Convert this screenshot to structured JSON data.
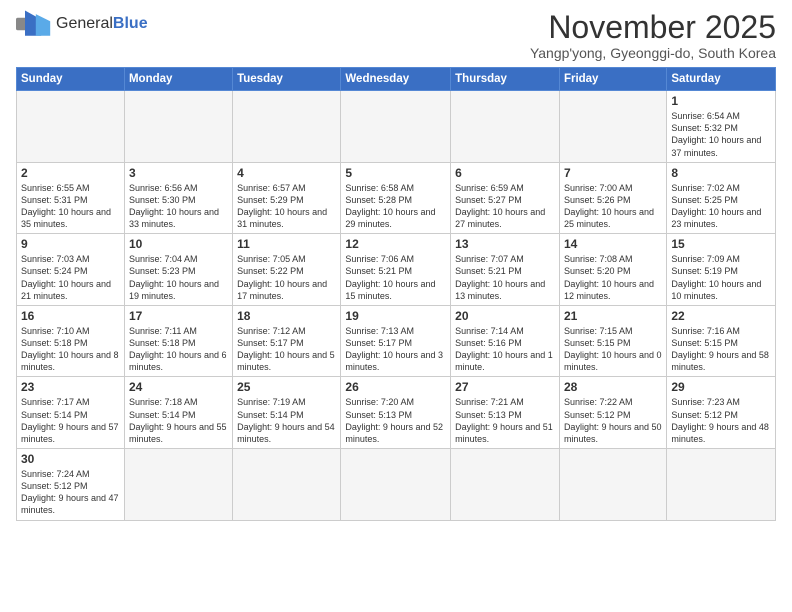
{
  "header": {
    "logo_general": "General",
    "logo_blue": "Blue",
    "month_title": "November 2025",
    "location": "Yangp'yong, Gyeonggi-do, South Korea"
  },
  "weekdays": [
    "Sunday",
    "Monday",
    "Tuesday",
    "Wednesday",
    "Thursday",
    "Friday",
    "Saturday"
  ],
  "weeks": [
    [
      {
        "day": "",
        "empty": true
      },
      {
        "day": "",
        "empty": true
      },
      {
        "day": "",
        "empty": true
      },
      {
        "day": "",
        "empty": true
      },
      {
        "day": "",
        "empty": true
      },
      {
        "day": "",
        "empty": true
      },
      {
        "day": "1",
        "sunrise": "6:54 AM",
        "sunset": "5:32 PM",
        "daylight": "10 hours and 37 minutes."
      }
    ],
    [
      {
        "day": "2",
        "sunrise": "6:55 AM",
        "sunset": "5:31 PM",
        "daylight": "10 hours and 35 minutes."
      },
      {
        "day": "3",
        "sunrise": "6:56 AM",
        "sunset": "5:30 PM",
        "daylight": "10 hours and 33 minutes."
      },
      {
        "day": "4",
        "sunrise": "6:57 AM",
        "sunset": "5:29 PM",
        "daylight": "10 hours and 31 minutes."
      },
      {
        "day": "5",
        "sunrise": "6:58 AM",
        "sunset": "5:28 PM",
        "daylight": "10 hours and 29 minutes."
      },
      {
        "day": "6",
        "sunrise": "6:59 AM",
        "sunset": "5:27 PM",
        "daylight": "10 hours and 27 minutes."
      },
      {
        "day": "7",
        "sunrise": "7:00 AM",
        "sunset": "5:26 PM",
        "daylight": "10 hours and 25 minutes."
      },
      {
        "day": "8",
        "sunrise": "7:02 AM",
        "sunset": "5:25 PM",
        "daylight": "10 hours and 23 minutes."
      }
    ],
    [
      {
        "day": "9",
        "sunrise": "7:03 AM",
        "sunset": "5:24 PM",
        "daylight": "10 hours and 21 minutes."
      },
      {
        "day": "10",
        "sunrise": "7:04 AM",
        "sunset": "5:23 PM",
        "daylight": "10 hours and 19 minutes."
      },
      {
        "day": "11",
        "sunrise": "7:05 AM",
        "sunset": "5:22 PM",
        "daylight": "10 hours and 17 minutes."
      },
      {
        "day": "12",
        "sunrise": "7:06 AM",
        "sunset": "5:21 PM",
        "daylight": "10 hours and 15 minutes."
      },
      {
        "day": "13",
        "sunrise": "7:07 AM",
        "sunset": "5:21 PM",
        "daylight": "10 hours and 13 minutes."
      },
      {
        "day": "14",
        "sunrise": "7:08 AM",
        "sunset": "5:20 PM",
        "daylight": "10 hours and 12 minutes."
      },
      {
        "day": "15",
        "sunrise": "7:09 AM",
        "sunset": "5:19 PM",
        "daylight": "10 hours and 10 minutes."
      }
    ],
    [
      {
        "day": "16",
        "sunrise": "7:10 AM",
        "sunset": "5:18 PM",
        "daylight": "10 hours and 8 minutes."
      },
      {
        "day": "17",
        "sunrise": "7:11 AM",
        "sunset": "5:18 PM",
        "daylight": "10 hours and 6 minutes."
      },
      {
        "day": "18",
        "sunrise": "7:12 AM",
        "sunset": "5:17 PM",
        "daylight": "10 hours and 5 minutes."
      },
      {
        "day": "19",
        "sunrise": "7:13 AM",
        "sunset": "5:17 PM",
        "daylight": "10 hours and 3 minutes."
      },
      {
        "day": "20",
        "sunrise": "7:14 AM",
        "sunset": "5:16 PM",
        "daylight": "10 hours and 1 minute."
      },
      {
        "day": "21",
        "sunrise": "7:15 AM",
        "sunset": "5:15 PM",
        "daylight": "10 hours and 0 minutes."
      },
      {
        "day": "22",
        "sunrise": "7:16 AM",
        "sunset": "5:15 PM",
        "daylight": "9 hours and 58 minutes."
      }
    ],
    [
      {
        "day": "23",
        "sunrise": "7:17 AM",
        "sunset": "5:14 PM",
        "daylight": "9 hours and 57 minutes."
      },
      {
        "day": "24",
        "sunrise": "7:18 AM",
        "sunset": "5:14 PM",
        "daylight": "9 hours and 55 minutes."
      },
      {
        "day": "25",
        "sunrise": "7:19 AM",
        "sunset": "5:14 PM",
        "daylight": "9 hours and 54 minutes."
      },
      {
        "day": "26",
        "sunrise": "7:20 AM",
        "sunset": "5:13 PM",
        "daylight": "9 hours and 52 minutes."
      },
      {
        "day": "27",
        "sunrise": "7:21 AM",
        "sunset": "5:13 PM",
        "daylight": "9 hours and 51 minutes."
      },
      {
        "day": "28",
        "sunrise": "7:22 AM",
        "sunset": "5:12 PM",
        "daylight": "9 hours and 50 minutes."
      },
      {
        "day": "29",
        "sunrise": "7:23 AM",
        "sunset": "5:12 PM",
        "daylight": "9 hours and 48 minutes."
      }
    ],
    [
      {
        "day": "30",
        "sunrise": "7:24 AM",
        "sunset": "5:12 PM",
        "daylight": "9 hours and 47 minutes."
      },
      {
        "day": "",
        "empty": true
      },
      {
        "day": "",
        "empty": true
      },
      {
        "day": "",
        "empty": true
      },
      {
        "day": "",
        "empty": true
      },
      {
        "day": "",
        "empty": true
      },
      {
        "day": "",
        "empty": true
      }
    ]
  ]
}
